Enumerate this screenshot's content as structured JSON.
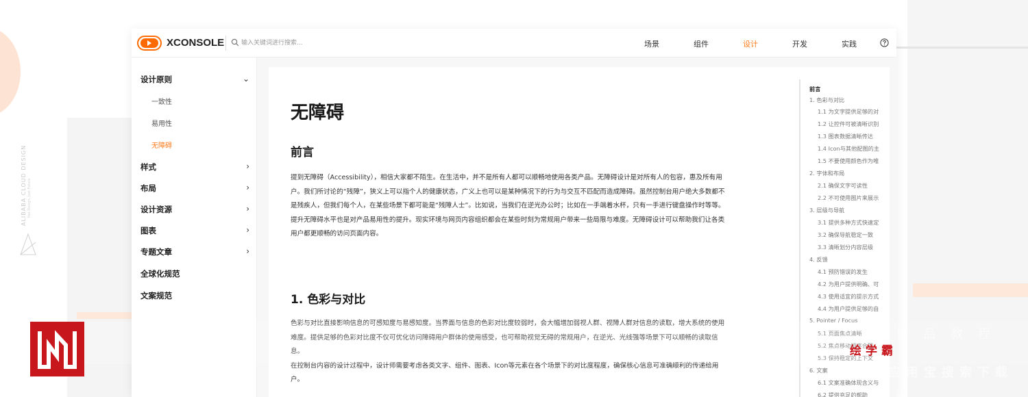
{
  "backdrop": {
    "brand_line1": "ALIBABA CLOUD DESIGN",
    "brand_line2": "Not Design, Just Future"
  },
  "header": {
    "logo_text": "XCONSOLE",
    "search_placeholder": "输入关键词进行搜索...",
    "nav": [
      {
        "label": "场景",
        "active": false
      },
      {
        "label": "组件",
        "active": false
      },
      {
        "label": "设计",
        "active": true
      },
      {
        "label": "开发",
        "active": false
      },
      {
        "label": "实践",
        "active": false
      }
    ],
    "help_icon": "help-circle-icon"
  },
  "sidebar": {
    "group_title": "设计原则",
    "sub_items": [
      {
        "label": "一致性",
        "active": false
      },
      {
        "label": "易用性",
        "active": false
      },
      {
        "label": "无障碍",
        "active": true
      }
    ],
    "items": [
      {
        "label": "样式",
        "has_arrow": true
      },
      {
        "label": "布局",
        "has_arrow": true
      },
      {
        "label": "设计资源",
        "has_arrow": true
      },
      {
        "label": "图表",
        "has_arrow": true
      },
      {
        "label": "专题文章",
        "has_arrow": true
      },
      {
        "label": "全球化规范",
        "has_arrow": false
      },
      {
        "label": "文案规范",
        "has_arrow": false
      }
    ]
  },
  "content": {
    "title": "无障碍",
    "preface_title": "前言",
    "preface_lines": [
      "提到无障碍（Accessibility），相信大家都不陌生。在生活中，并不是所有人都可以顺畅地使用各类产品。无障碍设计是对所有人的包容，惠及所有用",
      "户。我们所讨论的“残障”，狭义上可以指个人的健康状态，广义上也可以是某种情况下的行为与交互不匹配而造成障碍。虽然控制台用户绝大多数都不",
      "是残疾人，但我们每个人，在某些场景下都可能是“残障人士”。比如说，当我们在逆光办公时；比如在一手端着水杯，只有一手进行键盘操作时等等。",
      "提升无障碍水平也是对产品易用性的提升。现实环境与网页内容组织都会在某些时刻为常规用户带来一些局限与难度。无障碍设计可以帮助我们让各类",
      "用户都更顺畅的访问页面内容。"
    ],
    "section1_title": "1. 色彩与对比",
    "section1_lines": [
      "色彩与对比直接影响信息的可感知度与易感知度。当界面与信息的色彩对比度较弱时，会大幅增加弱视人群、视障人群对信息的读取，增大系统的使用",
      "难度。提供足够的色彩对比度不仅可优化访问障碍用户群体的使用感受，也可帮助视觉无碍的常规用户，在逆光、光线强等场景下可以顺畅的读取信",
      "息。",
      "在控制台内容的设计过程中，设计师需要考虑各类文字、组件、图表、Icon等元素在各个场景下的对比度程度，确保核心信息可准确顺利的传递给用",
      "户。"
    ]
  },
  "toc": {
    "items": [
      {
        "label": "前言",
        "level": "head"
      },
      {
        "label": "1. 色彩与对比",
        "level": "l1"
      },
      {
        "label": "1.1 为文字提供足够的对",
        "level": "l2"
      },
      {
        "label": "1.2 让控件可被清晰识别",
        "level": "l2"
      },
      {
        "label": "1.3 图表数据清晰传达",
        "level": "l2"
      },
      {
        "label": "1.4 Icon与其他配图的主",
        "level": "l2"
      },
      {
        "label": "1.5 不要使用颜色作为唯",
        "level": "l2"
      },
      {
        "label": "2. 字体和布局",
        "level": "l1"
      },
      {
        "label": "2.1 确保文字可读性",
        "level": "l2"
      },
      {
        "label": "2.2 不可使用图片来展示",
        "level": "l2"
      },
      {
        "label": "3. 层级与导航",
        "level": "l1"
      },
      {
        "label": "3.1 提供多种方式快速定",
        "level": "l2"
      },
      {
        "label": "3.2 确保导航稳定一致",
        "level": "l2"
      },
      {
        "label": "3.3 清晰划分内容层级",
        "level": "l2"
      },
      {
        "label": "4. 反馈",
        "level": "l1"
      },
      {
        "label": "4.1 预防错误的发生",
        "level": "l2"
      },
      {
        "label": "4.2 为用户提供明确、可",
        "level": "l2"
      },
      {
        "label": "4.3 使用适宜的提示方式",
        "level": "l2"
      },
      {
        "label": "4.4 为用户提供足够的自",
        "level": "l2"
      },
      {
        "label": "5. Pointer / Focus",
        "level": "l1"
      },
      {
        "label": "5.1 页面焦点清晰",
        "level": "l2"
      },
      {
        "label": "5.2 焦点移动顺序合理",
        "level": "l2"
      },
      {
        "label": "5.3 保持稳定的上下文",
        "level": "l2"
      },
      {
        "label": "6. 文案",
        "level": "l1"
      },
      {
        "label": "6.1 文案准确体现含义与",
        "level": "l2"
      },
      {
        "label": "6.2 提供充足的帮助",
        "level": "l2"
      }
    ]
  },
  "watermark": {
    "strong": "绘学霸",
    "faint_right": "费 精 品 教 程",
    "faint_right2": "应用宝搜索下载"
  },
  "colors": {
    "accent": "#ff7a1a",
    "watermark_red": "#c8161d",
    "logo_orange": "#ff6a00"
  }
}
